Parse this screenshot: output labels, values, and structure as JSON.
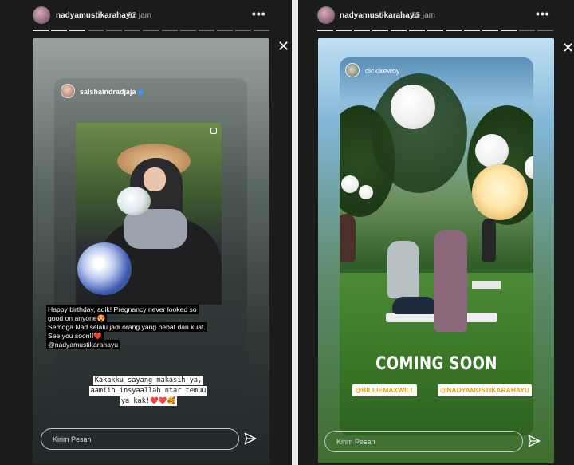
{
  "left_story": {
    "username": "nadyamustikarahayu",
    "time": "22 jam",
    "progress": {
      "total": 13,
      "done": 3
    },
    "shared_post": {
      "username": "salshaindradjaja",
      "caption_lines": [
        "Happy birthday, adik! Pregnancy never looked so",
        "good on anyone😍",
        "Semoga Nad selalu jadi orang yang hebat dan kuat.",
        "See you soon!!❤️",
        "@nadyamustikarahayu"
      ]
    },
    "reply_lines": [
      "Kakakku sayang makasih ya,",
      "aamiin insyaallah ntar temuu",
      "ya kak!❤️❤️🥰"
    ],
    "message_placeholder": "Kirim Pesan"
  },
  "right_story": {
    "username": "nadyamustikarahayu",
    "time": "15 jam",
    "progress": {
      "total": 13,
      "done": 11
    },
    "shared_post": {
      "username": "dickikewoy",
      "headline": "COMING SOON",
      "tags": [
        "@BILLIEMAXWILL",
        "@NADYAMUSTIKARAHAYU"
      ]
    },
    "message_placeholder": "Kirim Pesan"
  },
  "icons": {
    "more": "more-options-icon",
    "close": "close-icon",
    "send": "send-icon",
    "verified": "verified-badge-icon"
  }
}
